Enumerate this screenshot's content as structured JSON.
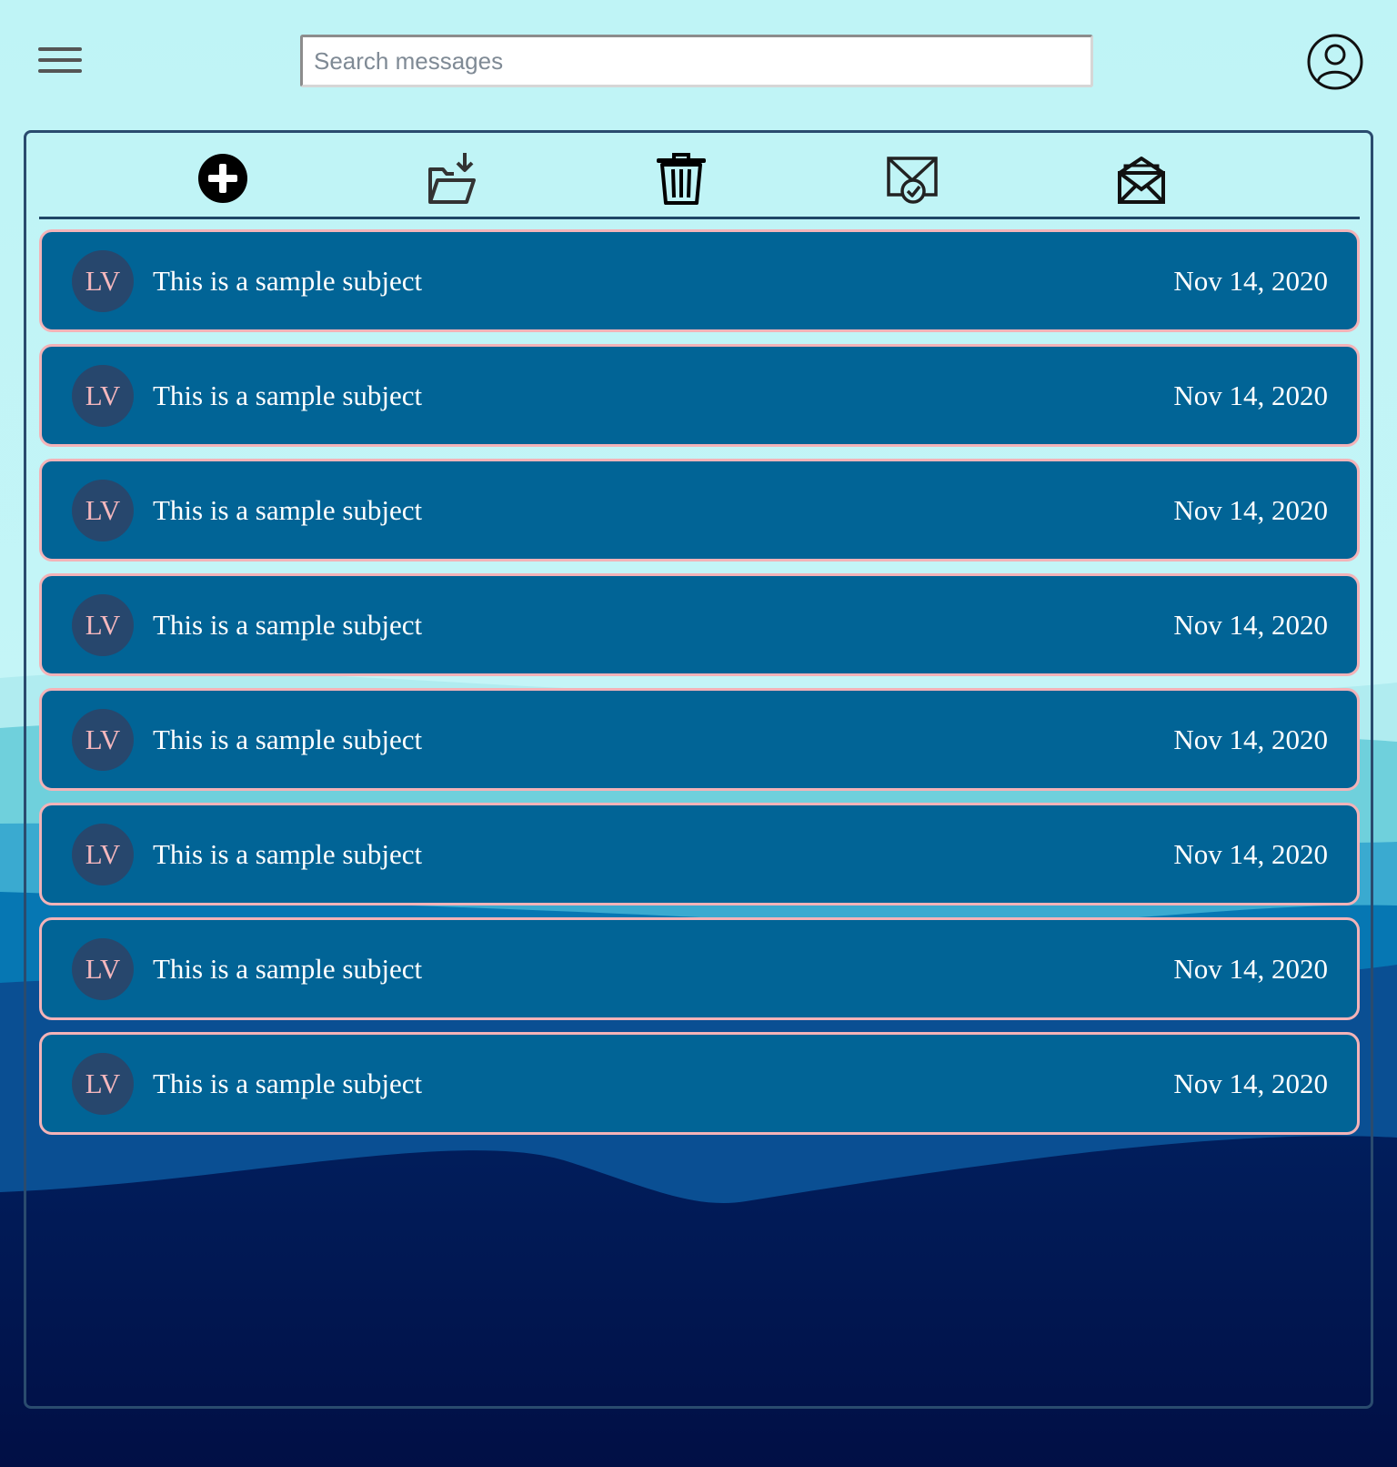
{
  "search": {
    "placeholder": "Search messages",
    "value": ""
  },
  "icons": {
    "menu": "hamburger-menu-icon",
    "profile": "user-profile-icon",
    "compose": "plus-circle-icon",
    "move": "folder-download-icon",
    "delete": "trash-icon",
    "mark_read": "envelope-check-icon",
    "mark_unread": "envelope-open-icon"
  },
  "messages": [
    {
      "initials": "LV",
      "subject": "This is a sample subject",
      "date": "Nov 14, 2020"
    },
    {
      "initials": "LV",
      "subject": "This is a sample subject",
      "date": "Nov 14, 2020"
    },
    {
      "initials": "LV",
      "subject": "This is a sample subject",
      "date": "Nov 14, 2020"
    },
    {
      "initials": "LV",
      "subject": "This is a sample subject",
      "date": "Nov 14, 2020"
    },
    {
      "initials": "LV",
      "subject": "This is a sample subject",
      "date": "Nov 14, 2020"
    },
    {
      "initials": "LV",
      "subject": "This is a sample subject",
      "date": "Nov 14, 2020"
    },
    {
      "initials": "LV",
      "subject": "This is a sample subject",
      "date": "Nov 14, 2020"
    },
    {
      "initials": "LV",
      "subject": "This is a sample subject",
      "date": "Nov 14, 2020"
    }
  ],
  "colors": {
    "sky": "#bff4f6",
    "row_bg": "#016496",
    "row_border": "#f3b3b8",
    "avatar_bg": "#27476d",
    "avatar_text": "#f5b7bd",
    "deep": "#001a55"
  }
}
